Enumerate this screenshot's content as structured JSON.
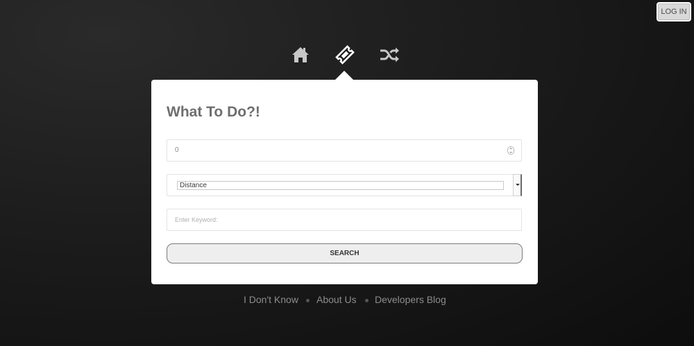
{
  "header": {
    "login_label": "LOG IN"
  },
  "nav": {
    "icons": [
      "home-icon",
      "ticket-icon",
      "shuffle-icon"
    ],
    "active": "ticket-icon",
    "active_color": "#ffffff",
    "inactive_color": "#c8c8c8"
  },
  "panel": {
    "title": "What To Do?!",
    "number_value": "0",
    "select_value": "Distance",
    "keyword_placeholder": "Enter Keyword:",
    "search_label": "SEARCH"
  },
  "footer": {
    "links": [
      "I Don't Know",
      "About Us",
      "Developers Blog"
    ]
  }
}
